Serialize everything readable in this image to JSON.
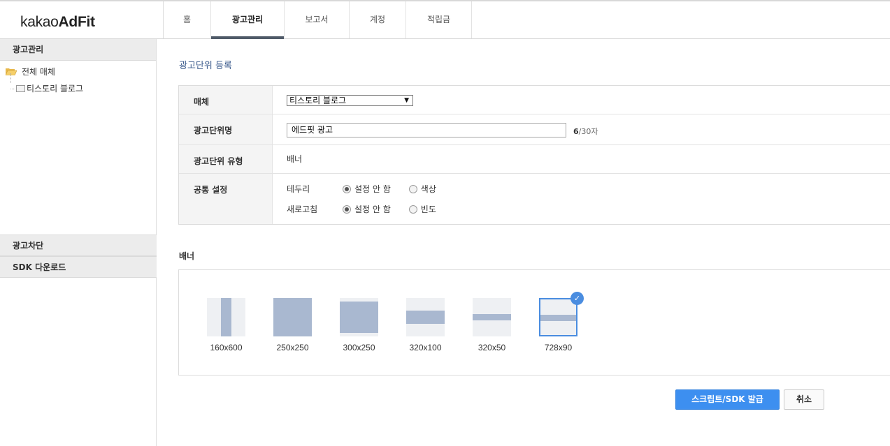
{
  "brand": {
    "prefix": "kakao",
    "name": "AdFit"
  },
  "nav": {
    "tabs": [
      {
        "label": "홈"
      },
      {
        "label": "광고관리",
        "active": true
      },
      {
        "label": "보고서"
      },
      {
        "label": "계정"
      },
      {
        "label": "적립금"
      }
    ]
  },
  "sidebar": {
    "header": "광고관리",
    "tree": {
      "root": "전체 매체",
      "child": "티스토리 블로그"
    },
    "sections": [
      "광고차단",
      "SDK 다운로드"
    ]
  },
  "main": {
    "title": "광고단위 등록",
    "form": {
      "media_label": "매체",
      "media_value": "티스토리 블로그",
      "name_label": "광고단위명",
      "name_value": "에드핏 광고",
      "name_count": "6",
      "name_max": "/30자",
      "type_label": "광고단위 유형",
      "type_value": "배너",
      "common_label": "공통 설정",
      "border_label": "테두리",
      "border_opt1": "설정 안 함",
      "border_opt2": "색상",
      "refresh_label": "새로고침",
      "refresh_opt1": "설정 안 함",
      "refresh_opt2": "빈도"
    },
    "banner_title": "배너",
    "sizes": [
      {
        "label": "160x600"
      },
      {
        "label": "250x250"
      },
      {
        "label": "300x250"
      },
      {
        "label": "320x100"
      },
      {
        "label": "320x50"
      },
      {
        "label": "728x90",
        "selected": true
      }
    ],
    "submit_label": "스크립트/SDK 발급",
    "cancel_label": "취소"
  },
  "colors": {
    "primary": "#3d8ff0",
    "thumb_fill": "#a9b8d0",
    "title": "#3a5a8c"
  }
}
